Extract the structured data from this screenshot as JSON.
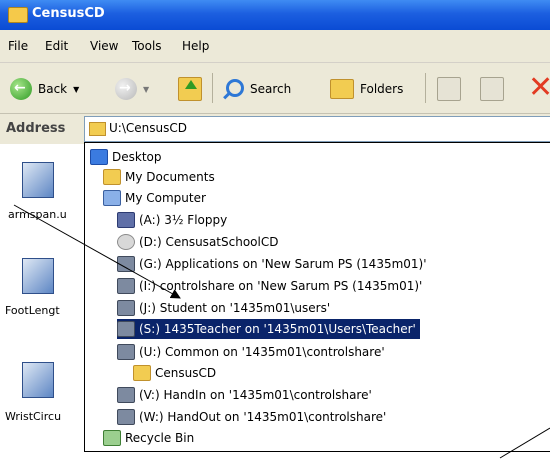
{
  "window": {
    "title": "CensusCD"
  },
  "menu": [
    "File",
    "Edit",
    "View",
    "Tools",
    "Help"
  ],
  "toolbar": {
    "back_label": "Back",
    "search_label": "Search",
    "folders_label": "Folders",
    "back_icon": "back-arrow-icon",
    "forward_icon": "forward-arrow-icon",
    "up_icon": "folder-up-icon",
    "search_icon": "magnifier-icon",
    "folders_icon": "folders-icon",
    "delete_icon": "delete-x-icon"
  },
  "address": {
    "label": "Address",
    "value": "U:\\CensusCD"
  },
  "files": [
    "armspan.u",
    "FootLengt",
    "WristCircu"
  ],
  "dropdown": [
    {
      "label": "Desktop",
      "icon": "desktop"
    },
    {
      "label": "My Documents",
      "icon": "docs"
    },
    {
      "label": "My Computer",
      "icon": "comp"
    },
    {
      "label": "(A:) 3½ Floppy",
      "icon": "floppy"
    },
    {
      "label": "(D:) CensusatSchoolCD",
      "icon": "cd"
    },
    {
      "label": "(G:) Applications on 'New Sarum PS (1435m01)'",
      "icon": "net"
    },
    {
      "label": "(I:) controlshare on 'New Sarum PS (1435m01)'",
      "icon": "net"
    },
    {
      "label": "(J:) Student on '1435m01\\users'",
      "icon": "net"
    },
    {
      "label": "(S:) 1435Teacher on '1435m01\\Users\\Teacher'",
      "icon": "net",
      "selected": true
    },
    {
      "label": "(U:) Common on '1435m01\\controlshare'",
      "icon": "net"
    },
    {
      "label": "CensusCD",
      "icon": "folder"
    },
    {
      "label": "(V:) HandIn on '1435m01\\controlshare'",
      "icon": "net"
    },
    {
      "label": "(W:) HandOut on '1435m01\\controlshare'",
      "icon": "net"
    },
    {
      "label": "Recycle Bin",
      "icon": "bin"
    }
  ],
  "colors": {
    "title_bar": "#0a4bd4",
    "selection": "#0a246a",
    "chrome": "#ece9d8"
  }
}
